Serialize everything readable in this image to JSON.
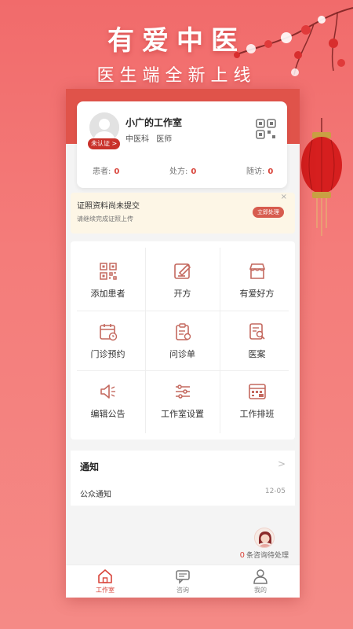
{
  "promo": {
    "title": "有爱中医",
    "subtitle": "医生端全新上线"
  },
  "profile": {
    "name": "小广的工作室",
    "department": "中医科",
    "role": "医师",
    "badge": "未认证 >",
    "stats": [
      {
        "label": "患者:",
        "value": "0"
      },
      {
        "label": "处方:",
        "value": "0"
      },
      {
        "label": "随访:",
        "value": "0"
      }
    ]
  },
  "notice": {
    "title": "证照资料尚未提交",
    "desc": "请继续完成证照上传",
    "button": "立即处理",
    "close": "×"
  },
  "grid": [
    {
      "label": "添加患者",
      "icon": "qr-add-icon"
    },
    {
      "label": "开方",
      "icon": "edit-icon"
    },
    {
      "label": "有爱好方",
      "icon": "shop-icon"
    },
    {
      "label": "门诊预约",
      "icon": "calendar-icon"
    },
    {
      "label": "问诊单",
      "icon": "clipboard-icon"
    },
    {
      "label": "医案",
      "icon": "case-search-icon"
    },
    {
      "label": "编辑公告",
      "icon": "speaker-icon"
    },
    {
      "label": "工作室设置",
      "icon": "sliders-icon"
    },
    {
      "label": "工作排班",
      "icon": "schedule-icon"
    }
  ],
  "notify": {
    "title": "通知",
    "arrow": ">",
    "item": "公众通知",
    "date": "12-05"
  },
  "consult": {
    "count": "0",
    "text": "条咨询待处理"
  },
  "tabs": [
    {
      "label": "工作室",
      "icon": "home-icon",
      "active": true
    },
    {
      "label": "咨询",
      "icon": "chat-icon",
      "active": false
    },
    {
      "label": "我的",
      "icon": "user-icon",
      "active": false
    }
  ],
  "colors": {
    "accent": "#d9443a",
    "header": "#e0534a",
    "background": "#f16b6b"
  }
}
